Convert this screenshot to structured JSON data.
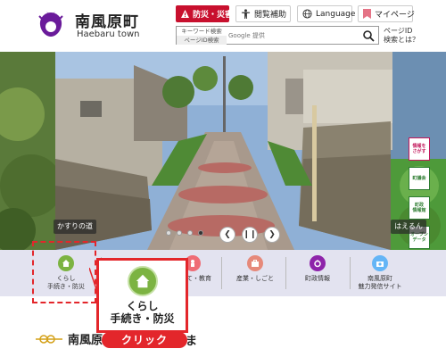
{
  "header": {
    "site_name": "南風原町",
    "site_name_en": "Haebaru town",
    "disaster_btn": "防災・災害",
    "access_btn": "閲覧補助",
    "language_btn": "Language",
    "mypage_btn": "マイページ",
    "search": {
      "keyword_tab": "キーワード検索",
      "page_id_tab": "ページID検索",
      "placeholder": "Google 提供"
    },
    "page_id_help": "ページID\n検索とは？"
  },
  "hero": {
    "caption_left": "かすりの道",
    "caption_right": "はえるん",
    "side_tabs": [
      "情報を\nさがす",
      "町議会",
      "町政\n情報館",
      "オープン\nデータ"
    ]
  },
  "categories": [
    {
      "label": "くらし\n手続き・防災",
      "color": "#7cb342"
    },
    {
      "label": "子育て・教育",
      "color": "#ef6c75"
    },
    {
      "label": "産業・しごと",
      "color": "#e6897a"
    },
    {
      "label": "町政情報",
      "color": "#8e24aa"
    },
    {
      "label": "南風原町\n魅力発信サイト",
      "color": "#64b5f6"
    }
  ],
  "zoom": {
    "line1": "くらし",
    "line2": "手続き・防災",
    "click_label": "クリック"
  },
  "section": {
    "title_visible": "南風原",
    "title_tail": "ま"
  }
}
